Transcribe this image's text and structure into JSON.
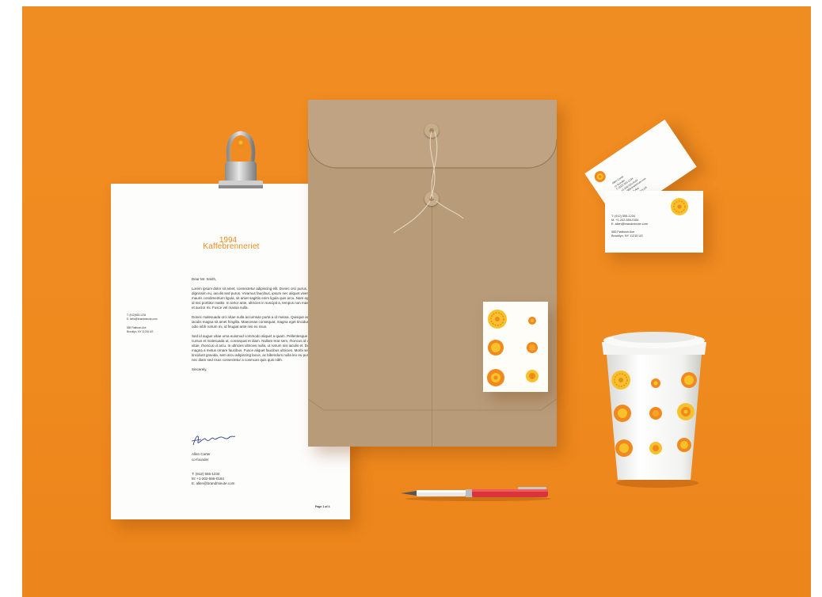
{
  "letterhead": {
    "brand_year": "1994",
    "brand_name": "Kaffebrenneriet",
    "side_phone": "T: (912)553-1234",
    "side_email": "E: hello@brandminute.com",
    "side_address1": "555 Flatbush Ave",
    "side_address2": "Brooklyn, NY 11215 US",
    "salutation": "Dear Mr. Smith,",
    "paragraph1": "Lorem ipsum dolor sit amet, consectetur adipiscing elit. Donec orci purus, luctus vitae dignissim eu, iaculis sed purus. Vivamus faucibus, ipsum nec aliquet viverra, leo mauris condimentum ligula, sit amet sagittis enim ligula quis arcu. Nam egestas tortor id nisi porttitor mattis. In tortor ante, ultricies in suscipit a, tempus non massa. Vivamus et auctor mi. Fusce vel massa nulla.",
    "paragraph2": "Donec malesuada orci vitae nulla accumsan porta a id massa. Quisque accumsan iaculis magna sit amet fringilla. Maecenas consequat, magna eget tincidunt semper, odio nibh rutrum mi, id feugiat ante nisi eu risus.",
    "paragraph3": "Sed id augue vitae urna euismod commodo aliquet a quam. Pellentesque arcu velit, cursus et malesuada ut, consequat et diam. Nullam erat sem, rhoncus id ullamcorper vitae, rhoncus ut arcu. In ultricies ultricies nulla, ut rutrum nisi iaculis et. Donec eu magna a metus ornare faucibus. Fusce aliquet faucibus ultricies. Morbi semper, est id tincidunt gravida, sem arcu adipiscing lacus, ac bibendum nulla leo eu purus. Quisque nec diam sed risus consectetur a cosmcan quis quis nibh.",
    "closing": "Sincerely,",
    "signer_name": "Allen Carter",
    "signer_title": "co-founder",
    "contact_t": "T:  (912) 555-1234",
    "contact_m": "M: +1-202-555-0184",
    "contact_e": "E:  allen@brandminute.com",
    "page_number": "Page 1 of 4"
  },
  "business_card": {
    "name": "Allen Carter",
    "title": "co-founder",
    "t": "T:  (912) 555-1234",
    "m": "M: +1-202-555-0184",
    "e": "E:  allen@brandminute.com",
    "address1": "555 Flatbush Ave",
    "address2": "Brooklyn, NY 11215 US"
  },
  "colors": {
    "background": "#ef8a1f",
    "accent_orange": "#f08a1d",
    "accent_yellow": "#f6c12a",
    "kraft": "#b89c7a",
    "pen_red": "#d8343a"
  }
}
